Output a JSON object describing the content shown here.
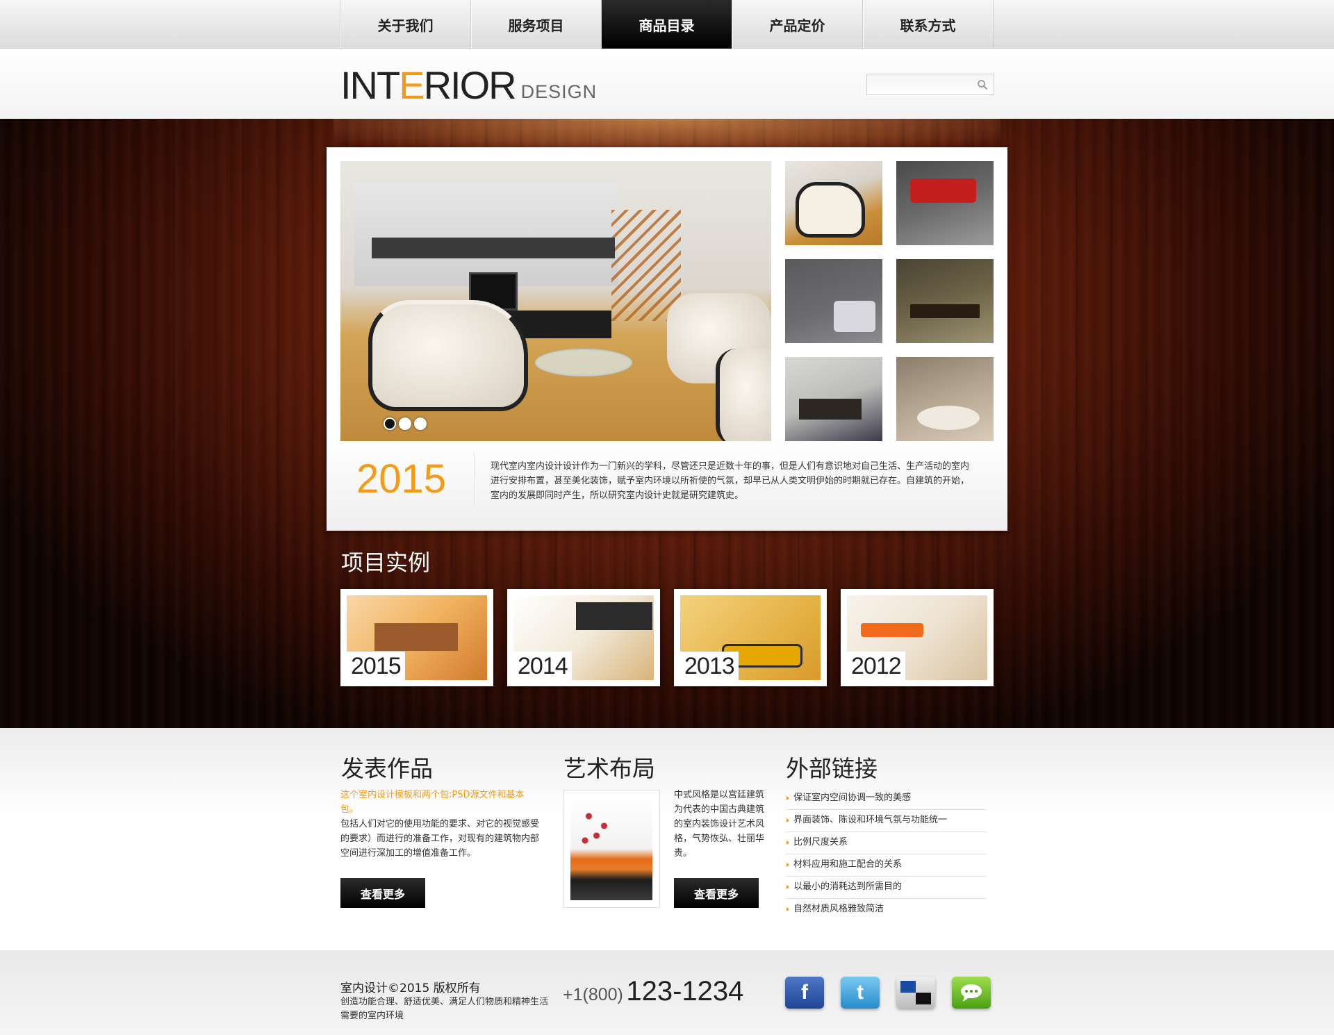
{
  "nav": {
    "items": [
      {
        "label": "关于我们"
      },
      {
        "label": "服务项目"
      },
      {
        "label": "商品目录",
        "active": true
      },
      {
        "label": "产品定价"
      },
      {
        "label": "联系方式"
      }
    ]
  },
  "header": {
    "logo_part1": "INT",
    "logo_accent": "E",
    "logo_part2": "RIOR",
    "logo_sub": "DESIGN",
    "search": {
      "value": "",
      "placeholder": "",
      "icon": "search-icon"
    }
  },
  "feature": {
    "slider_dots": 3,
    "active_dot": 0,
    "year": "2015",
    "text": "现代室内室内设计设计作为一门新兴的学科，尽管还只是近数十年的事，但是人们有意识地对自己生活、生产活动的室内进行安排布置，甚至美化装饰，赋予室内环境以所祈使的气氛，却早已从人类文明伊始的时期就已存在。自建筑的开始，室内的发展即同时产生，所以研究室内设计史就是研究建筑史。"
  },
  "projects": {
    "title": "项目实例",
    "items": [
      {
        "year": "2015"
      },
      {
        "year": "2014"
      },
      {
        "year": "2013"
      },
      {
        "year": "2012"
      }
    ]
  },
  "col1": {
    "title": "发表作品",
    "highlight": "这个室内设计模板和两个包:PSD源文件和基本包。",
    "text": "包括人们对它的使用功能的要求、对它的视觉感受的要求）而进行的准备工作，对现有的建筑物内部空间进行深加工的增值准备工作。",
    "button": "查看更多"
  },
  "col2": {
    "title": "艺术布局",
    "text": "中式风格是以宫廷建筑为代表的中国古典建筑的室内装饰设计艺术风格，气势恢弘、壮丽华贵。",
    "button": "查看更多"
  },
  "col3": {
    "title": "外部链接",
    "links": [
      {
        "label": "保证室内空间协调一致的美感"
      },
      {
        "label": "界面装饰、陈设和环境气氛与功能统一"
      },
      {
        "label": "比例尺度关系"
      },
      {
        "label": "材料应用和施工配合的关系"
      },
      {
        "label": "以最小的消耗达到所需目的"
      },
      {
        "label": "自然材质风格雅致简洁"
      }
    ]
  },
  "footer": {
    "copyright": "室内设计©2015 版权所有",
    "slogan": "创造功能合理、舒适优美、满足人们物质和精神生活需要的室内环境",
    "phone_prefix": "+1(800)",
    "phone_number": "123-1234",
    "socials": [
      {
        "icon": "facebook-icon",
        "glyph": "f"
      },
      {
        "icon": "twitter-icon",
        "glyph": "t"
      },
      {
        "icon": "delicious-icon",
        "glyph": ""
      },
      {
        "icon": "chat-icon",
        "glyph": ""
      }
    ]
  },
  "colors": {
    "accent": "#f39a16",
    "dark": "#000000",
    "wood": "#5d1c0b"
  }
}
